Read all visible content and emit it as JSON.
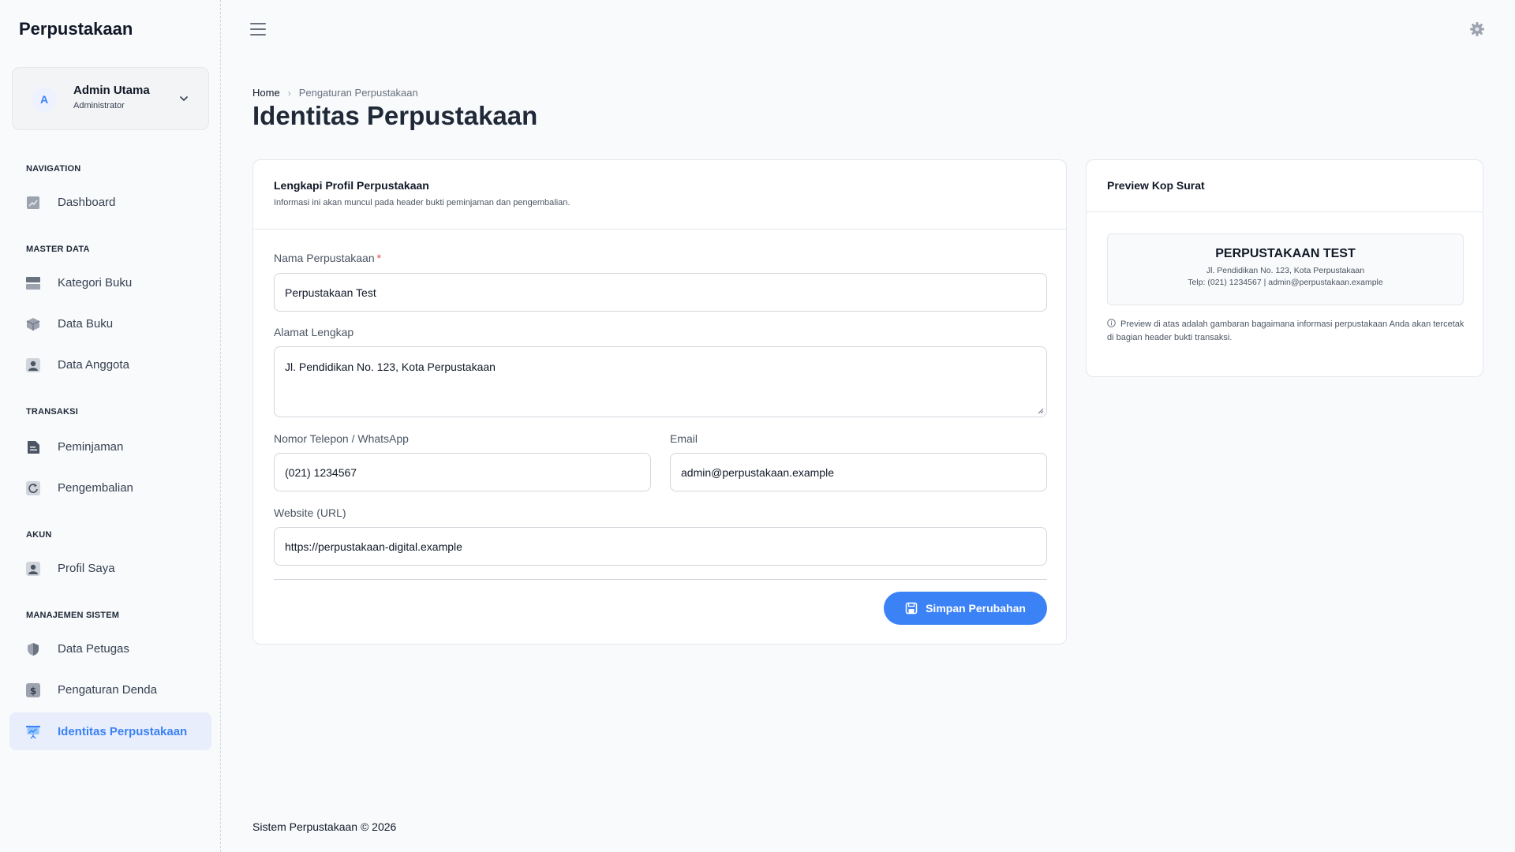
{
  "app": {
    "brand": "Perpustakaan"
  },
  "user": {
    "initial": "A",
    "name": "Admin Utama",
    "role": "Administrator"
  },
  "nav": {
    "sections": {
      "navigation": "NAVIGATION",
      "master": "MASTER DATA",
      "transaksi": "TRANSAKSI",
      "akun": "AKUN",
      "sistem": "MANAJEMEN SISTEM"
    },
    "items": {
      "dashboard": "Dashboard",
      "kategori": "Kategori Buku",
      "buku": "Data Buku",
      "anggota": "Data Anggota",
      "peminjaman": "Peminjaman",
      "pengembalian": "Pengembalian",
      "profil": "Profil Saya",
      "petugas": "Data Petugas",
      "denda": "Pengaturan Denda",
      "identitas": "Identitas Perpustakaan"
    },
    "active": "Identitas Perpustakaan"
  },
  "breadcrumb": {
    "home": "Home",
    "current": "Pengaturan Perpustakaan"
  },
  "page": {
    "title": "Identitas Perpustakaan"
  },
  "form": {
    "title": "Lengkapi Profil Perpustakaan",
    "subtitle": "Informasi ini akan muncul pada header bukti peminjaman dan pengembalian.",
    "nama_label": "Nama Perpustakaan",
    "required_mark": "*",
    "nama_value": "Perpustakaan Test",
    "alamat_label": "Alamat Lengkap",
    "alamat_value": "Jl. Pendidikan No. 123, Kota Perpustakaan",
    "telepon_label": "Nomor Telepon / WhatsApp",
    "telepon_value": "(021) 1234567",
    "email_label": "Email",
    "email_value": "admin@perpustakaan.example",
    "website_label": "Website (URL)",
    "website_value": "https://perpustakaan-digital.example",
    "save_label": "Simpan Perubahan"
  },
  "preview": {
    "title": "Preview Kop Surat",
    "kop_name": "PERPUSTAKAAN TEST",
    "kop_address": "Jl. Pendidikan No. 123, Kota Perpustakaan",
    "kop_contact": "Telp: (021) 1234567 | admin@perpustakaan.example",
    "note": "Preview di atas adalah gambaran bagaimana informasi perpustakaan Anda akan tercetak di bagian header bukti transaksi."
  },
  "footer": {
    "text": "Sistem Perpustakaan © 2026"
  },
  "colors": {
    "accent": "#3b82f6",
    "active_bg": "#e8eefb",
    "required": "#ef4444"
  }
}
